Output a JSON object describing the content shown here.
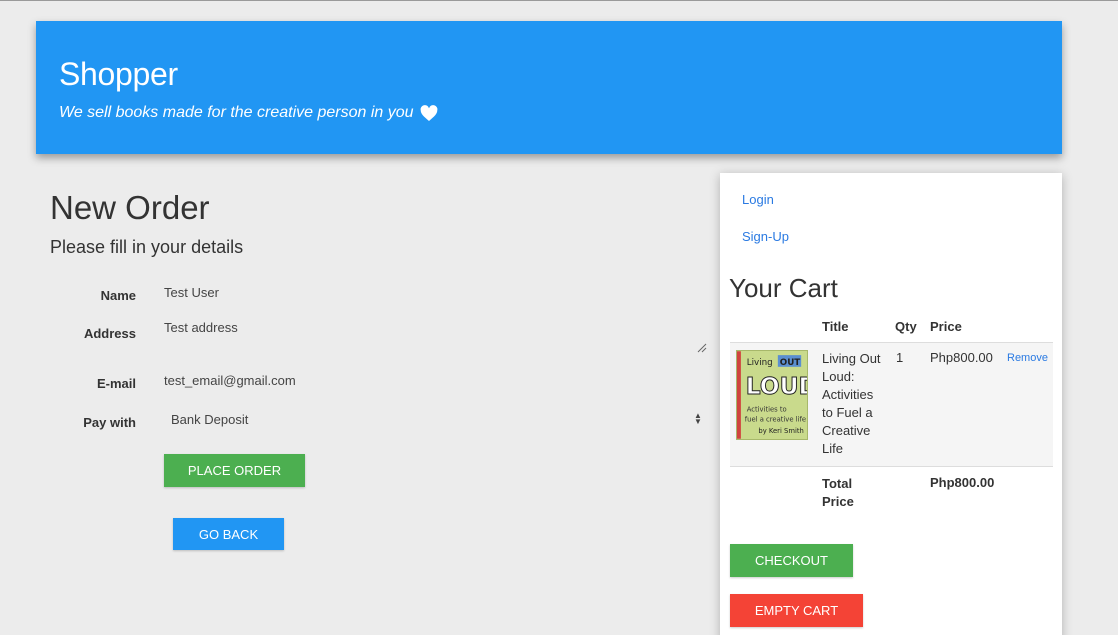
{
  "header": {
    "title": "Shopper",
    "tagline": "We sell books made for the creative person in you"
  },
  "order": {
    "title": "New Order",
    "subtitle": "Please fill in your details",
    "fields": {
      "name_label": "Name",
      "name_value": "Test User",
      "address_label": "Address",
      "address_value": "Test address",
      "email_label": "E-mail",
      "email_value": "test_email@gmail.com",
      "pay_label": "Pay with",
      "pay_value": "Bank Deposit"
    },
    "place_order_label": "PLACE ORDER",
    "go_back_label": "GO BACK"
  },
  "sidebar": {
    "login_label": "Login",
    "signup_label": "Sign-Up"
  },
  "cart": {
    "title": "Your Cart",
    "headers": {
      "title": "Title",
      "qty": "Qty",
      "price": "Price"
    },
    "items": [
      {
        "title": "Living Out Loud: Activities to Fuel a Creative Life",
        "qty": "1",
        "price": "Php800.00",
        "remove_label": "Remove"
      }
    ],
    "total_label": "Total Price",
    "total_value": "Php800.00",
    "checkout_label": "CHECKOUT",
    "empty_label": "EMPTY CART"
  },
  "colors": {
    "primary": "#2196f3",
    "success": "#4caf50",
    "danger": "#f44336",
    "link": "#2a7ae2"
  }
}
